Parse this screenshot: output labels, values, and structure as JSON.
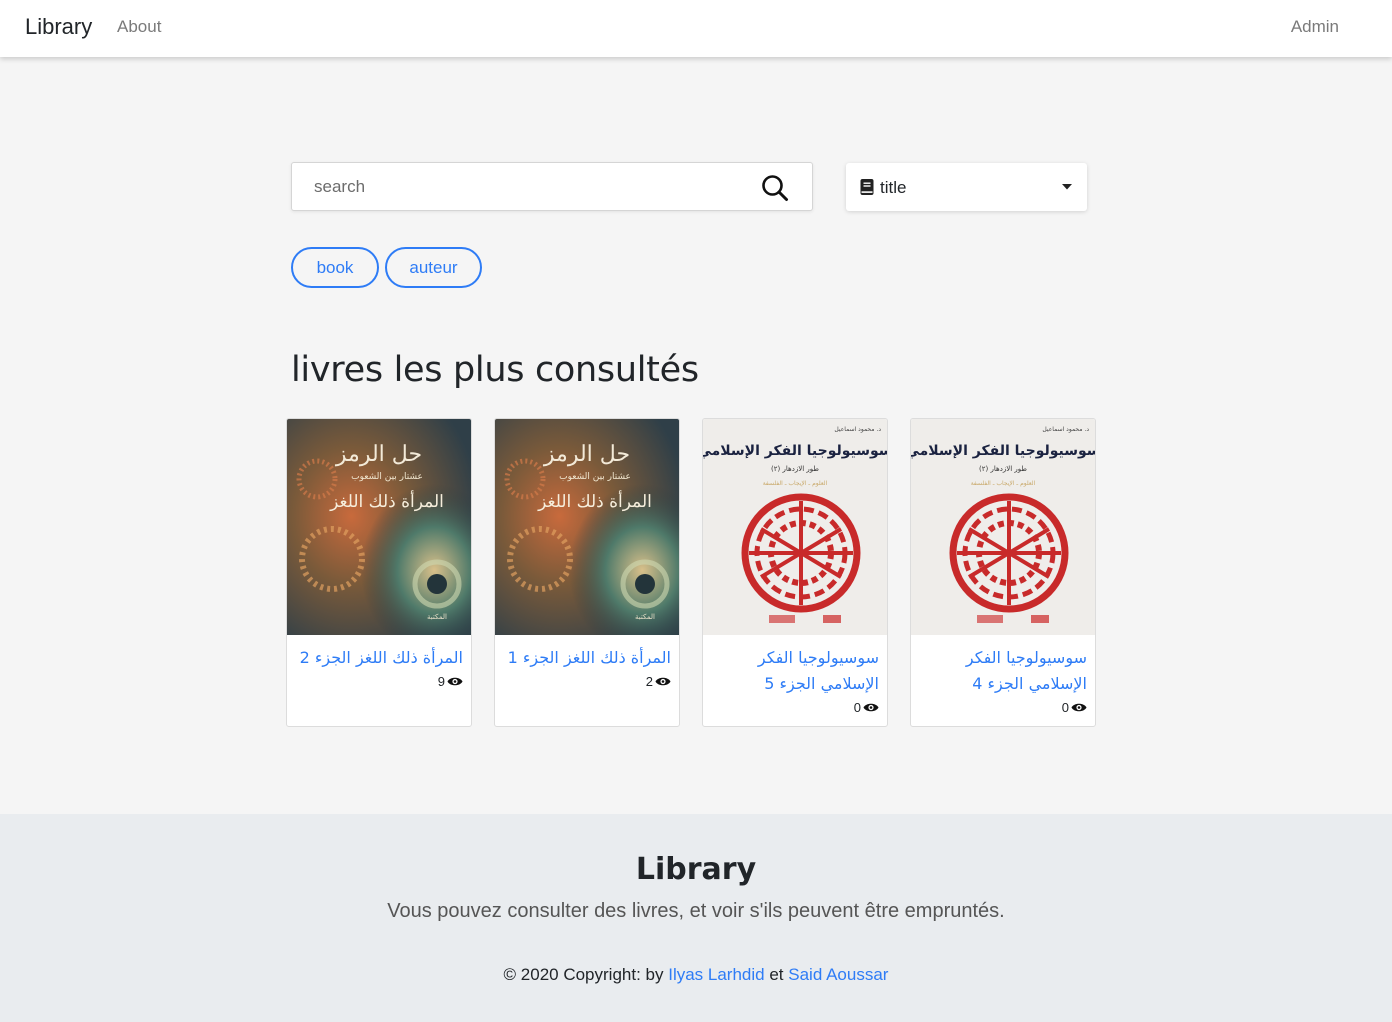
{
  "navbar": {
    "brand": "Library",
    "about": "About",
    "admin": "Admin"
  },
  "search": {
    "placeholder": "search",
    "filter_selected": "title",
    "filter_icon": "book-icon"
  },
  "filters": {
    "book": "book",
    "auteur": "auteur"
  },
  "section": {
    "title": "livres les plus consultés"
  },
  "books": [
    {
      "title": "المرأة ذلك اللغز الجزء 2",
      "views": "9"
    },
    {
      "title": "المرأة ذلك اللغز الجزء 1",
      "views": "2"
    },
    {
      "title": "سوسيولوجيا الفكر الإسلامي الجزء 5",
      "views": "0"
    },
    {
      "title": "سوسيولوجيا الفكر الإسلامي الجزء 4",
      "views": "0"
    }
  ],
  "footer": {
    "title": "Library",
    "lead": "Vous pouvez consulter des livres, et voir s'ils peuvent être empruntés.",
    "copyright_prefix": "© 2020 Copyright: by",
    "author1": "Ilyas Larhdid",
    "conjunction": "et",
    "author2": "Said Aoussar"
  },
  "colors": {
    "accent": "#2e7cf6",
    "page_bg": "#f5f5f5",
    "footer_bg": "#e9ecef"
  }
}
